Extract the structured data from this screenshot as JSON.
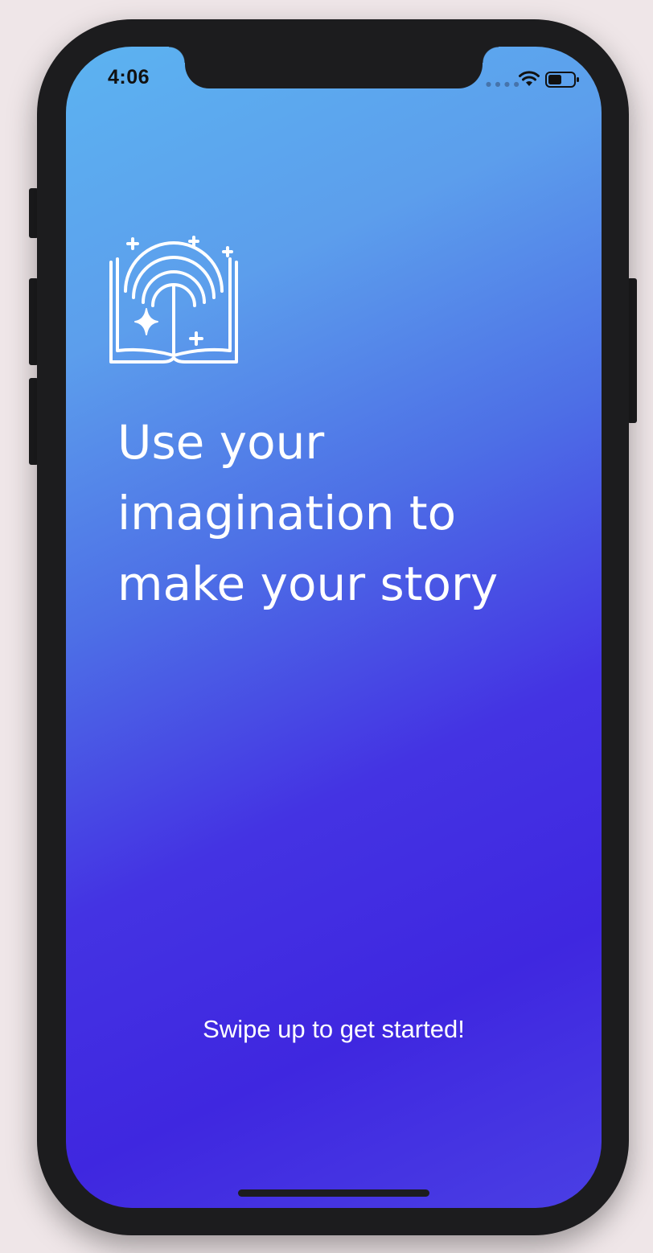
{
  "status_bar": {
    "time": "4:06",
    "signal_icon": "signal-dots-icon",
    "wifi_icon": "wifi-icon",
    "battery_icon": "battery-icon"
  },
  "hero": {
    "icon": "magic-book-icon",
    "headline_lines": [
      "Use your",
      "imagination to",
      "make your story"
    ]
  },
  "footer": {
    "swipe_text": "Swipe up to get started!"
  },
  "colors": {
    "gradient_start": "#5cb3f1",
    "gradient_end": "#3f27e0",
    "text": "#ffffff",
    "device_frame": "#1c1c1e"
  }
}
